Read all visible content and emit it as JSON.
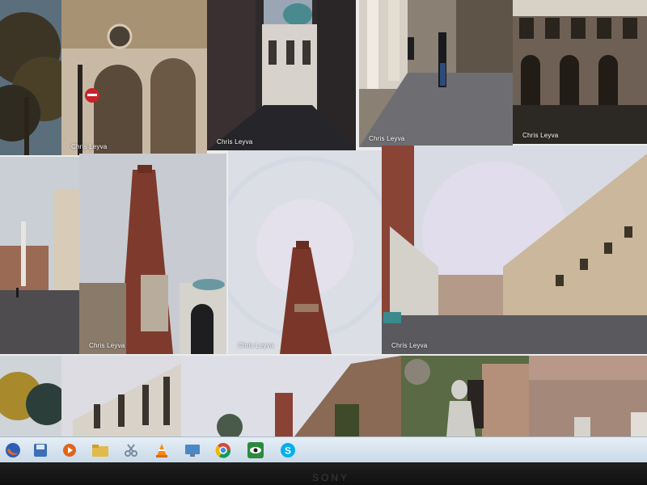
{
  "gallery": {
    "photo_credit": "Chris Leyva"
  },
  "taskbar": {
    "icons": [
      {
        "name": "firefox-icon",
        "color": "#e8662a"
      },
      {
        "name": "save-disk-icon",
        "color": "#3b6fb6"
      },
      {
        "name": "media-player-icon",
        "color": "#e0651c"
      },
      {
        "name": "folder-icon",
        "color": "#e2b94b"
      },
      {
        "name": "scissors-icon",
        "color": "#7a8aa0"
      },
      {
        "name": "vlc-cone-icon",
        "color": "#ff8800"
      },
      {
        "name": "display-icon",
        "color": "#4a88c8"
      },
      {
        "name": "chrome-icon",
        "color": "#3b8de0"
      },
      {
        "name": "eye-app-icon",
        "color": "#2c8a3e"
      },
      {
        "name": "skype-icon",
        "color": "#00aff0"
      }
    ]
  },
  "monitor": {
    "brand": "SONY"
  }
}
